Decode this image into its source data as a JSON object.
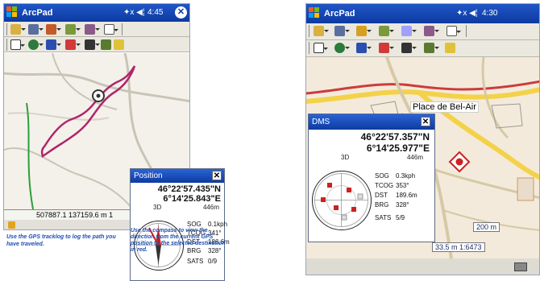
{
  "left": {
    "app_title": "ArcPad",
    "status_icons": "✦x ◀¦",
    "time": "4:45",
    "close_label": "✕",
    "map_status": "507887.1 137159.6 m 1",
    "position_dialog": {
      "title": "Position",
      "close_label": "✕",
      "latitude": "46°22'57.435\"N",
      "longitude": "6°14'25.843\"E",
      "fix": "3D",
      "altitude": "446m",
      "readouts": [
        {
          "label": "SOG",
          "value": "0.1kph"
        },
        {
          "label": "TCOG",
          "value": "341°"
        },
        {
          "label": "DST",
          "value": "186.6m"
        },
        {
          "label": "BRG",
          "value": "328°"
        },
        {
          "label": "SATS",
          "value": "0/9"
        }
      ]
    },
    "caption1": "Use the GPS tracklog to log the path you have traveled.",
    "caption2": "Use the compass to view the direction from the current GPS position to the selected destination in red."
  },
  "right": {
    "app_title": "ArcPad",
    "status_icons": "✦x ◀¦",
    "time": "4:30",
    "place_label": "Place de Bel-Air",
    "scale_text": "200 m",
    "scale_readout": "33.5 m 1:6473",
    "dms_dialog": {
      "title": "DMS",
      "close_label": "✕",
      "latitude": "46°22'57.357\"N",
      "longitude": "6°14'25.977\"E",
      "fix": "3D",
      "altitude": "446m",
      "readouts": [
        {
          "label": "SOG",
          "value": "0.3kph"
        },
        {
          "label": "TCOG",
          "value": "353°"
        },
        {
          "label": "DST",
          "value": "189.6m"
        },
        {
          "label": "BRG",
          "value": "328°"
        },
        {
          "label": "SATS",
          "value": "5/9"
        }
      ]
    }
  },
  "colors": {
    "titlebar": "#0d3aa1",
    "track": "#b0246a",
    "caption": "#1d4fb3",
    "road_yellow": "#f3d24a",
    "road_red": "#cc3b3b",
    "road_green": "#2e9e3a"
  }
}
